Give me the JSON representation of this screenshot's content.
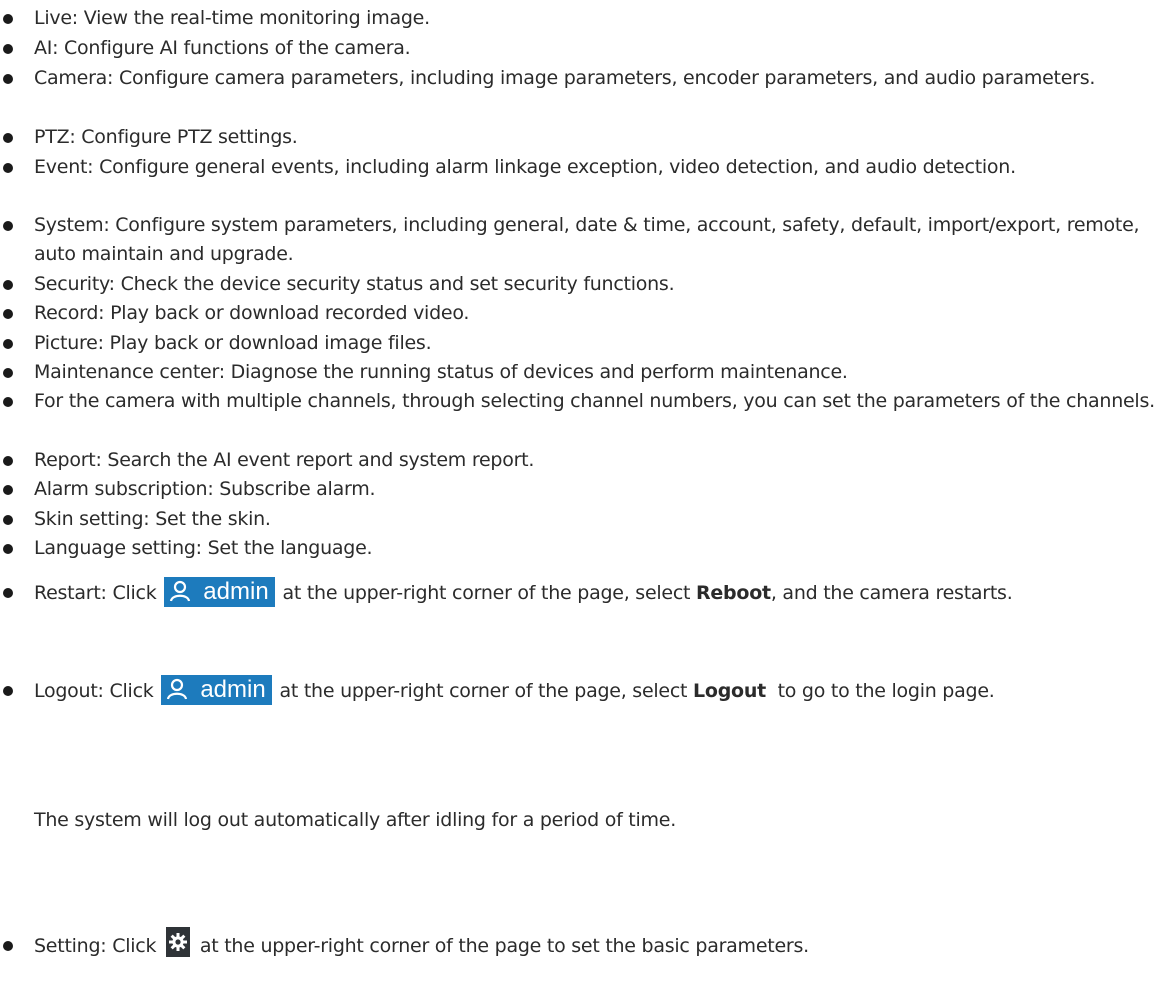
{
  "items": [
    {
      "text": "Live: View the real-time monitoring image."
    },
    {
      "text": "AI: Configure AI functions of the camera."
    },
    {
      "text": "Camera: Configure camera parameters, including image parameters, encoder parameters, and audio parameters."
    },
    {
      "text": "PTZ: Configure PTZ settings."
    },
    {
      "text": "Event: Configure general events, including alarm linkage exception, video detection, and audio detection."
    },
    {
      "text": "System: Configure system parameters, including general, date & time, account, safety, default, import/export, remote, auto maintain and upgrade."
    },
    {
      "text": "Security: Check the device security status and set security functions."
    },
    {
      "text": "Record: Play back or download recorded video."
    },
    {
      "text": "Picture: Play back or download image files."
    },
    {
      "text": "Maintenance center: Diagnose the running status of devices and perform maintenance."
    },
    {
      "text": "For the camera with multiple channels, through selecting channel numbers, you can set the parameters of the channels."
    },
    {
      "text": "Report: Search the AI event report and system report."
    },
    {
      "text": "Alarm subscription: Subscribe alarm."
    },
    {
      "text": "Skin setting: Set the skin."
    },
    {
      "text": "Language setting: Set the language."
    }
  ],
  "restart": {
    "before": "Restart: Click ",
    "chip_label": "admin",
    "middle": " at the upper-right corner of the page, select ",
    "bold": "Reboot",
    "after": ", and the camera restarts."
  },
  "logout": {
    "before": "Logout: Click ",
    "chip_label": "admin",
    "middle": " at the upper-right corner of the page, select ",
    "bold": "Logout",
    "after": "  to go to the login page.",
    "note": "The system will log out automatically after idling for a period of time."
  },
  "setting": {
    "before": "Setting: Click ",
    "after": " at the upper-right corner of the page to set the basic parameters."
  },
  "colors": {
    "chip": "#1d7bbd",
    "gear_bg": "#2f3337",
    "text": "#2b2b2b"
  },
  "icons": {
    "chip_icon": "user-icon",
    "setting_icon": "gear-icon"
  }
}
